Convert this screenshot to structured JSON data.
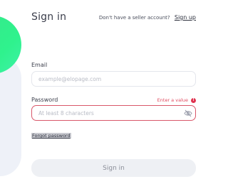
{
  "header": {
    "title": "Sign in",
    "no_account_text": "Don't have a seller account?",
    "signup_link": "Sign up"
  },
  "form": {
    "email": {
      "label": "Email",
      "placeholder": "example@elopage.com",
      "value": ""
    },
    "password": {
      "label": "Password",
      "placeholder": "At least 8 characters",
      "value": "",
      "error": "Enter a value",
      "error_icon_glyph": "!"
    },
    "forgot_password": "Forgot password",
    "submit_label": "Sign in"
  },
  "colors": {
    "accent_green": "#2ff28d",
    "error_red": "#e0334f",
    "button_bg": "#eef0f4"
  },
  "icons": [
    "eye-slash-icon",
    "error-icon"
  ]
}
